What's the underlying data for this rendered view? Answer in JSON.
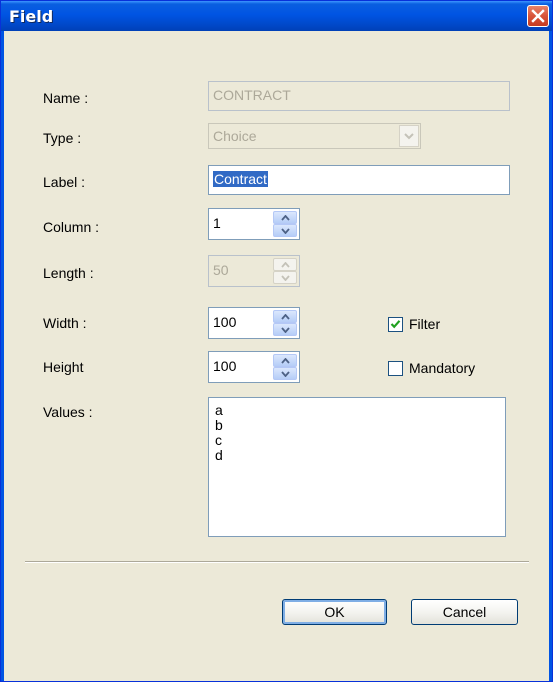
{
  "window": {
    "title": "Field",
    "close_icon": "close-icon"
  },
  "form": {
    "name": {
      "label": "Name :",
      "value": "CONTRACT"
    },
    "type": {
      "label": "Type :",
      "value": "Choice"
    },
    "label": {
      "label": "Label :",
      "value": "Contract"
    },
    "column": {
      "label": "Column :",
      "value": "1"
    },
    "length": {
      "label": "Length :",
      "value": "50"
    },
    "width": {
      "label": "Width :",
      "value": "100"
    },
    "height": {
      "label": "Height",
      "value": "100"
    },
    "values": {
      "label": "Values :",
      "items": [
        "a",
        "b",
        "c",
        "d"
      ]
    },
    "filter": {
      "label": "Filter",
      "checked": true
    },
    "mandatory": {
      "label": "Mandatory",
      "checked": false
    }
  },
  "buttons": {
    "ok": "OK",
    "cancel": "Cancel"
  },
  "colors": {
    "titlebar": "#0054e3",
    "dialog_bg": "#ece9d8",
    "selection": "#316ac5",
    "close_button": "#d8543a"
  }
}
